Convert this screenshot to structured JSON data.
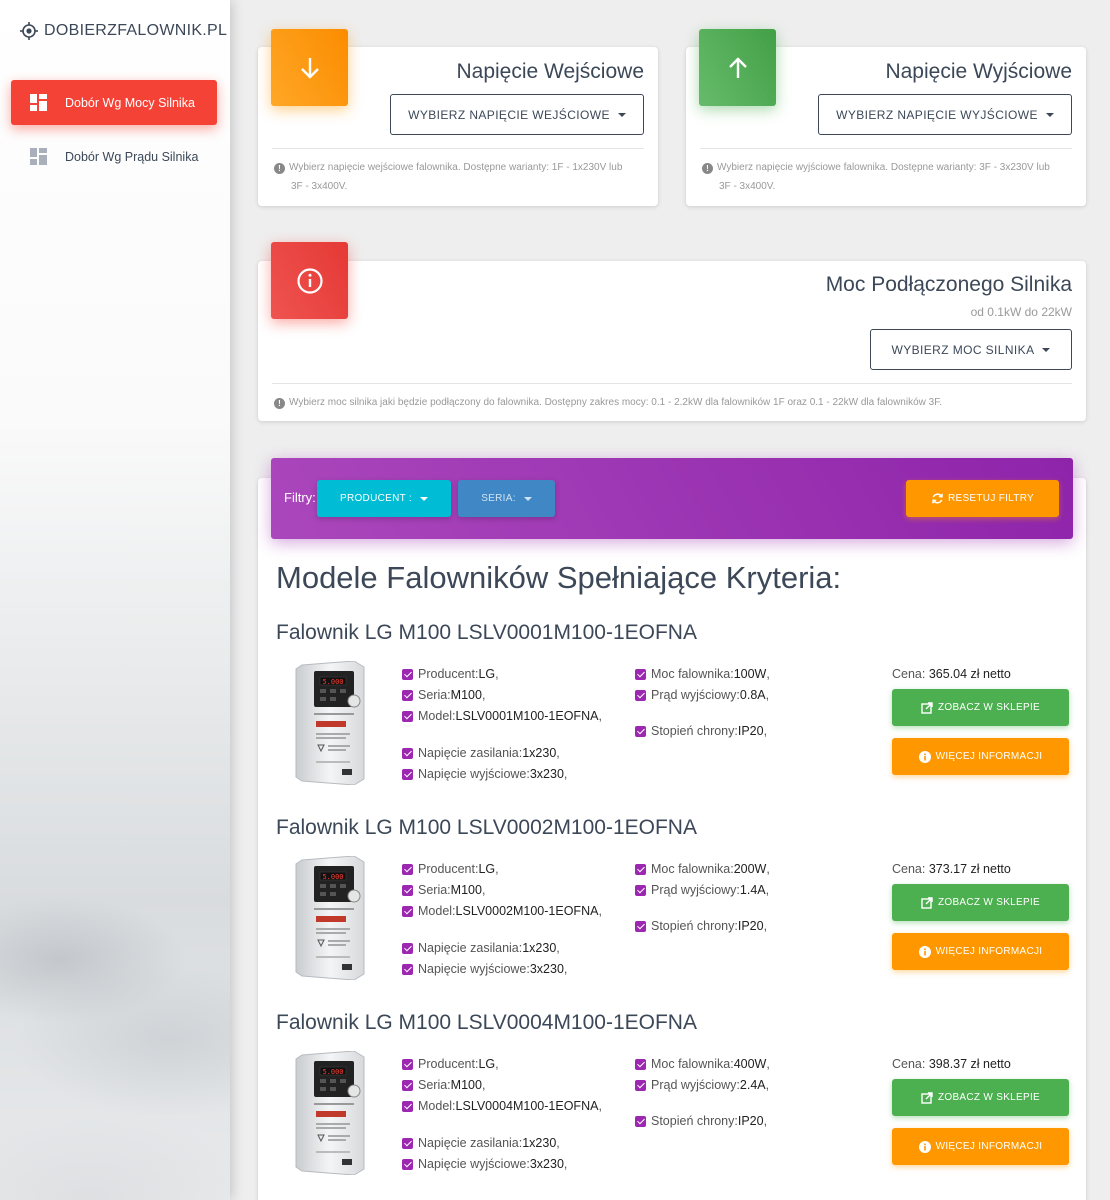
{
  "app": {
    "logo_text": "DOBIERZFALOWNIK.PL"
  },
  "sidebar": {
    "items": [
      {
        "label": "Dobór Wg Mocy Silnika",
        "active": true
      },
      {
        "label": "Dobór Wg Prądu Silnika",
        "active": false
      }
    ]
  },
  "input_voltage": {
    "title": "Napięcie Wejściowe",
    "button": "WYBIERZ NAPIĘCIE WEJŚCIOWE",
    "note_line1": "Wybierz napięcie wejściowe falownika. Dostępne warianty: 1F - 1x230V lub",
    "note_line2": "3F - 3x400V.",
    "icon_color": "#ff9800"
  },
  "output_voltage": {
    "title": "Napięcie Wyjściowe",
    "button": "WYBIERZ NAPIĘCIE WYJŚCIOWE",
    "note_line1": "Wybierz napięcie wyjściowe falownika. Dostępne warianty: 3F - 3x230V lub",
    "note_line2": "3F - 3x400V.",
    "icon_color": "#4caf50"
  },
  "motor_power": {
    "title": "Moc Podłączonego Silnika",
    "subtitle": "od 0.1kW do 22kW",
    "button": "WYBIERZ MOC SILNIKA",
    "note": "Wybierz moc silnika jaki będzie podłączony do falownika. Dostępny zakres mocy: 0.1 - 2.2kW dla falowników 1F oraz 0.1 - 22kW dla falowników 3F.",
    "icon_color": "#f44336"
  },
  "filters": {
    "label": "Filtry:",
    "producer": "PRODUCENT :",
    "series": "SERIA:",
    "reset": "RESETUJ FILTRY"
  },
  "results": {
    "title": "Modele Falowników Spełniające Kryteria:",
    "labels": {
      "producer": "Producent: ",
      "series": "Seria: ",
      "model": "Model:",
      "supply": "Napięcie zasilania: ",
      "out_voltage": "Napięcie wyjściowe: ",
      "power": "Moc falownika: ",
      "current": "Prąd wyjściowy: ",
      "protection": "Stopień chrony: ",
      "price": "Cena: ",
      "shop_btn": "ZOBACZ W SKLEPIE",
      "info_btn": "WIĘCEJ INFORMACJI"
    },
    "products": [
      {
        "title": "Falownik LG M100 LSLV0001M100-1EOFNA",
        "producer": "LG",
        "series": "M100",
        "model": "LSLV0001M100-1EOFNA",
        "supply": "1x230",
        "out_voltage": "3x230",
        "power": "100W",
        "current": "0.8A",
        "protection": "IP20",
        "price": "365.04 zł netto"
      },
      {
        "title": "Falownik LG M100 LSLV0002M100-1EOFNA",
        "producer": "LG",
        "series": "M100",
        "model": "LSLV0002M100-1EOFNA",
        "supply": "1x230",
        "out_voltage": "3x230",
        "power": "200W",
        "current": "1.4A",
        "protection": "IP20",
        "price": "373.17 zł netto"
      },
      {
        "title": "Falownik LG M100 LSLV0004M100-1EOFNA",
        "producer": "LG",
        "series": "M100",
        "model": "LSLV0004M100-1EOFNA",
        "supply": "1x230",
        "out_voltage": "3x230",
        "power": "400W",
        "current": "2.4A",
        "protection": "IP20",
        "price": "398.37 zł netto"
      }
    ]
  }
}
